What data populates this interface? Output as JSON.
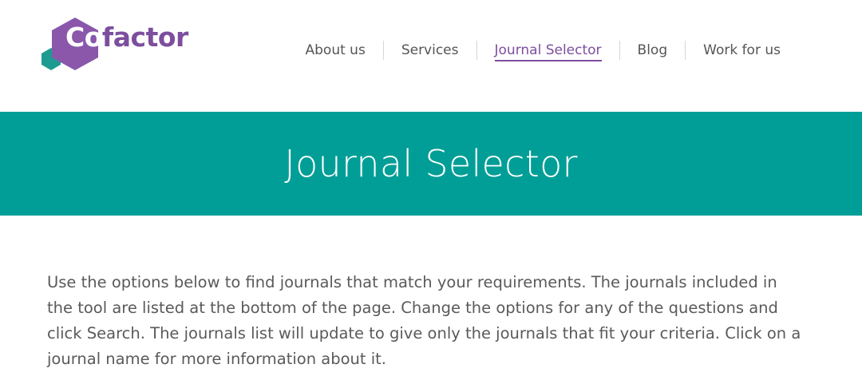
{
  "brand": {
    "logo_text_first": "Co",
    "logo_text_rest": "factor",
    "logo_icon": "hexagon-logo-icon",
    "colors": {
      "purple": "#7d4e9e",
      "teal_dark": "#1e9b91",
      "teal_banner": "#009e96"
    }
  },
  "nav": {
    "items": [
      {
        "label": "About us",
        "active": false
      },
      {
        "label": "Services",
        "active": false
      },
      {
        "label": "Journal Selector",
        "active": true
      },
      {
        "label": "Blog",
        "active": false
      },
      {
        "label": "Work for us",
        "active": false
      }
    ]
  },
  "banner": {
    "title": "Journal Selector"
  },
  "intro": {
    "text": "Use the options below to find journals that match your requirements. The journals included in the tool are listed at the bottom of the page. Change the options for any of the questions and click Search. The journals list will update to give only the journals that fit your criteria. Click on a journal name for more information about it."
  }
}
